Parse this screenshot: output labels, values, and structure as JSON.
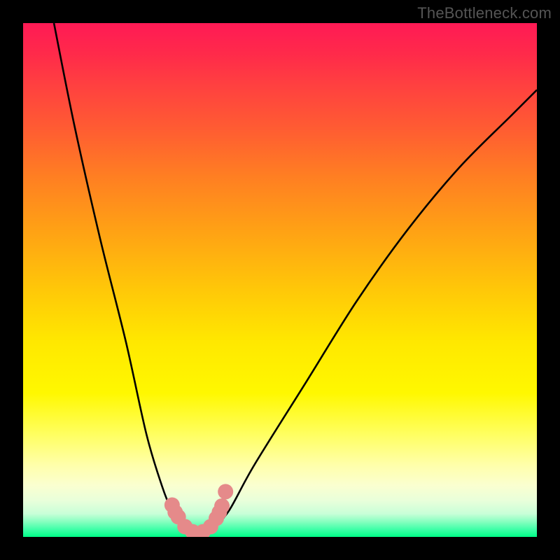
{
  "watermark": "TheBottleneck.com",
  "chart_data": {
    "type": "line",
    "title": "",
    "xlabel": "",
    "ylabel": "",
    "xlim": [
      0,
      100
    ],
    "ylim": [
      0,
      100
    ],
    "series": [
      {
        "name": "bottleneck-curve",
        "x": [
          6,
          10,
          15,
          20,
          24,
          27,
          29,
          31,
          33,
          35,
          37,
          40,
          45,
          55,
          65,
          75,
          85,
          95,
          100
        ],
        "values": [
          100,
          80,
          58,
          38,
          20,
          10,
          5,
          2,
          0.5,
          0.5,
          2,
          5,
          14,
          30,
          46,
          60,
          72,
          82,
          87
        ]
      }
    ],
    "markers": {
      "name": "highlighted-points",
      "x": [
        29.0,
        29.6,
        30.2,
        31.5,
        33.0,
        35.0,
        36.5,
        37.6,
        38.2,
        38.7,
        39.4
      ],
      "y": [
        6.2,
        4.8,
        3.9,
        2.0,
        1.0,
        1.0,
        2.0,
        3.6,
        4.8,
        6.0,
        8.8
      ]
    },
    "background_gradient": {
      "description": "vertical red-to-green bottleneck heatmap",
      "stops": [
        {
          "pos": 0.0,
          "color": "#ff1a55"
        },
        {
          "pos": 0.3,
          "color": "#ff7f22"
        },
        {
          "pos": 0.62,
          "color": "#ffe800"
        },
        {
          "pos": 0.9,
          "color": "#faffd0"
        },
        {
          "pos": 1.0,
          "color": "#00ff88"
        }
      ]
    }
  }
}
